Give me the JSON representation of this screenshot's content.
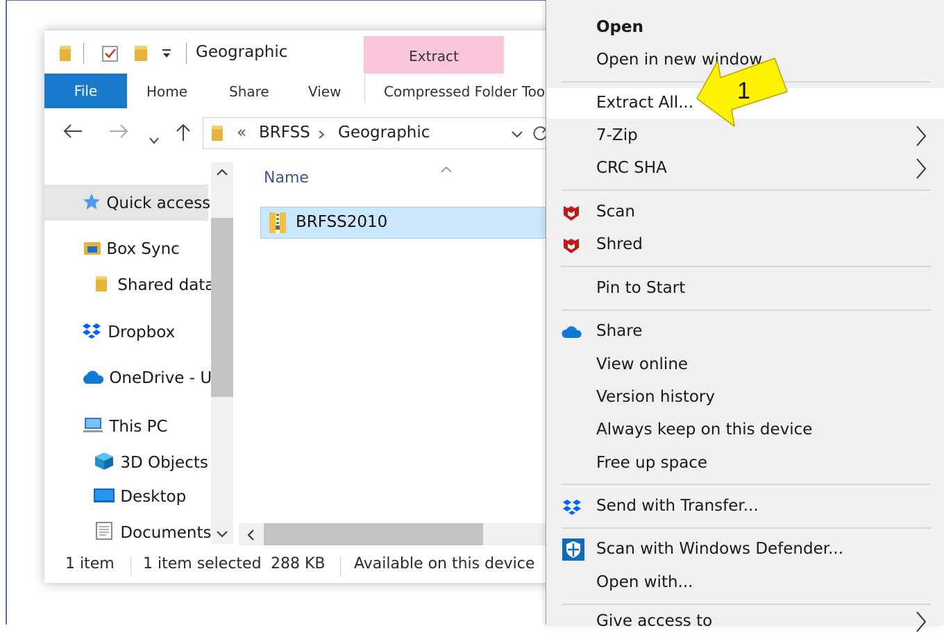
{
  "explorer": {
    "window_title": "Geographic",
    "contextual_tab": "Extract",
    "ribbon": {
      "file": "File",
      "home": "Home",
      "share": "Share",
      "view": "View",
      "tools": "Compressed Folder Too"
    },
    "address": {
      "overflow": "«",
      "crumb1": "BRFSS",
      "crumb2": "Geographic"
    },
    "sidebar": {
      "items": [
        {
          "label": "Quick access"
        },
        {
          "label": "Box Sync"
        },
        {
          "label": "Shared data"
        },
        {
          "label": "Dropbox"
        },
        {
          "label": "OneDrive - U"
        },
        {
          "label": "This PC"
        },
        {
          "label": "3D Objects"
        },
        {
          "label": "Desktop"
        },
        {
          "label": "Documents"
        }
      ]
    },
    "content": {
      "column_name": "Name",
      "files": [
        {
          "name": "BRFSS2010"
        }
      ]
    },
    "status": {
      "item_count": "1 item",
      "selected": "1 item selected",
      "size": "288 KB",
      "availability": "Available on this device"
    }
  },
  "context_menu": {
    "items": [
      {
        "label": "Open"
      },
      {
        "label": "Open in new window"
      },
      {
        "label": "Extract All..."
      },
      {
        "label": "7-Zip"
      },
      {
        "label": "CRC SHA"
      },
      {
        "label": "Scan"
      },
      {
        "label": "Shred"
      },
      {
        "label": "Pin to Start"
      },
      {
        "label": "Share"
      },
      {
        "label": "View online"
      },
      {
        "label": "Version history"
      },
      {
        "label": "Always keep on this device"
      },
      {
        "label": "Free up space"
      },
      {
        "label": "Send with Transfer..."
      },
      {
        "label": "Scan with Windows Defender..."
      },
      {
        "label": "Open with..."
      },
      {
        "label": "Give access to"
      }
    ]
  },
  "annotation": {
    "label": "1"
  },
  "colors": {
    "file_tab": "#1979ca",
    "extract_tab": "#f9c5dd",
    "selection": "#cce8ff",
    "arrow": "#fff200",
    "mcafee": "#c01818",
    "onedrive": "#0f78d4",
    "dropbox": "#0061fe"
  }
}
